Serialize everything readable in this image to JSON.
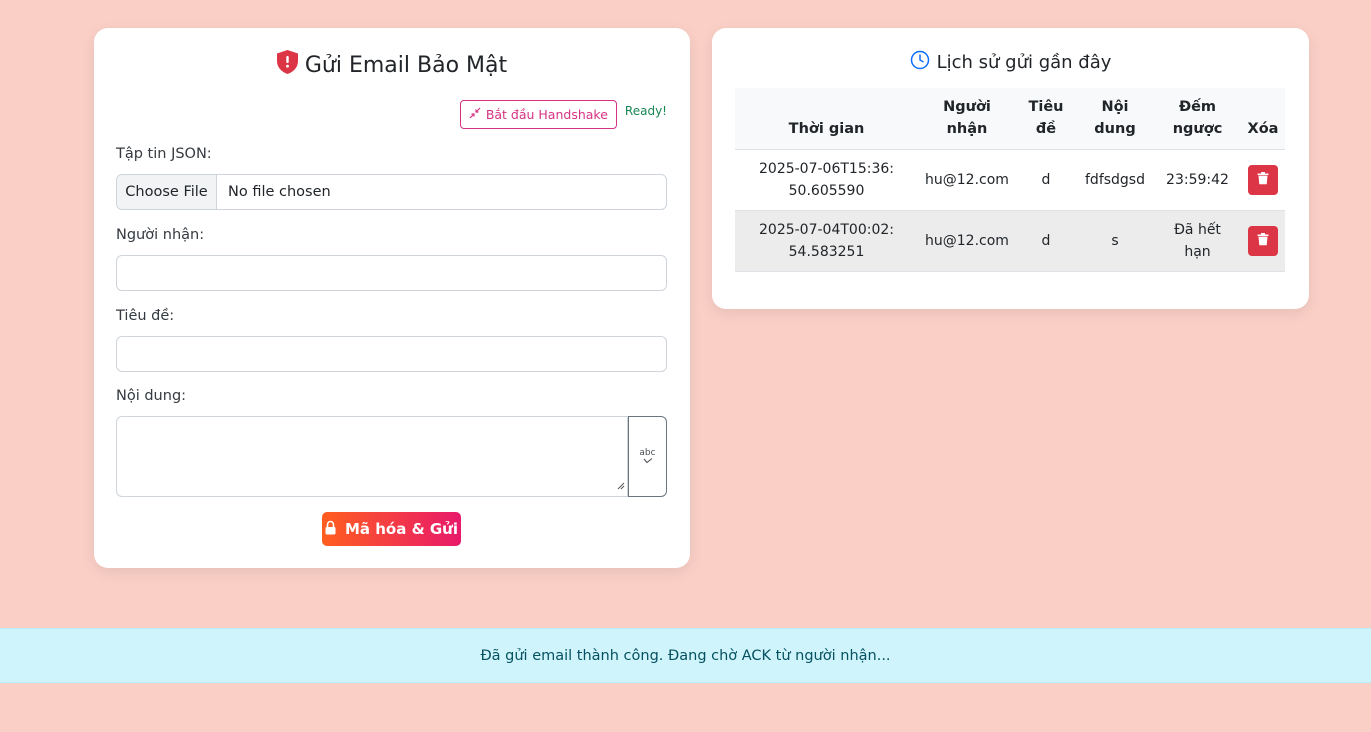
{
  "send_form": {
    "title": "Gửi Email Bảo Mật",
    "handshake_label": "Bắt đầu Handshake",
    "status": "Ready!",
    "json_file_label": "Tập tin JSON:",
    "file_button_label": "Choose File",
    "file_name": "No file chosen",
    "recipient_label": "Người nhận:",
    "recipient_value": "",
    "subject_label": "Tiêu đề:",
    "subject_value": "",
    "body_label": "Nội dung:",
    "body_value": "",
    "spellcheck_icon_text": "abc",
    "submit_label": "Mã hóa & Gửi"
  },
  "history": {
    "title": "Lịch sử gửi gần đây",
    "columns": [
      "Thời gian",
      "Người nhận",
      "Tiêu đề",
      "Nội dung",
      "Đếm ngược",
      "Xóa"
    ],
    "rows": [
      {
        "time": "2025-07-06T15:36:50.605590",
        "recipient": "hu@12.com",
        "subject": "d",
        "body": "fdfsdgsd",
        "countdown": "23:59:42"
      },
      {
        "time": "2025-07-04T00:02:54.583251",
        "recipient": "hu@12.com",
        "subject": "d",
        "body": "s",
        "countdown": "Đã hết hạn"
      }
    ]
  },
  "alert": {
    "message": "Đã gửi email thành công. Đang chờ ACK từ người nhận..."
  },
  "icons": {
    "title_icon": "shield-alert-icon",
    "history_icon": "clock-icon",
    "handshake_icon": "arrows-collapse-icon",
    "submit_icon": "lock-icon",
    "delete_icon": "trash-icon",
    "spellcheck_icon": "spellcheck-icon"
  },
  "colors": {
    "page_background": "#f9cfc6",
    "accent_pink": "#d63384",
    "danger": "#dc3545",
    "success": "#198754",
    "info_background": "#cff4fc",
    "gradient_start": "#ff5e1f",
    "gradient_end": "#e8196b"
  }
}
